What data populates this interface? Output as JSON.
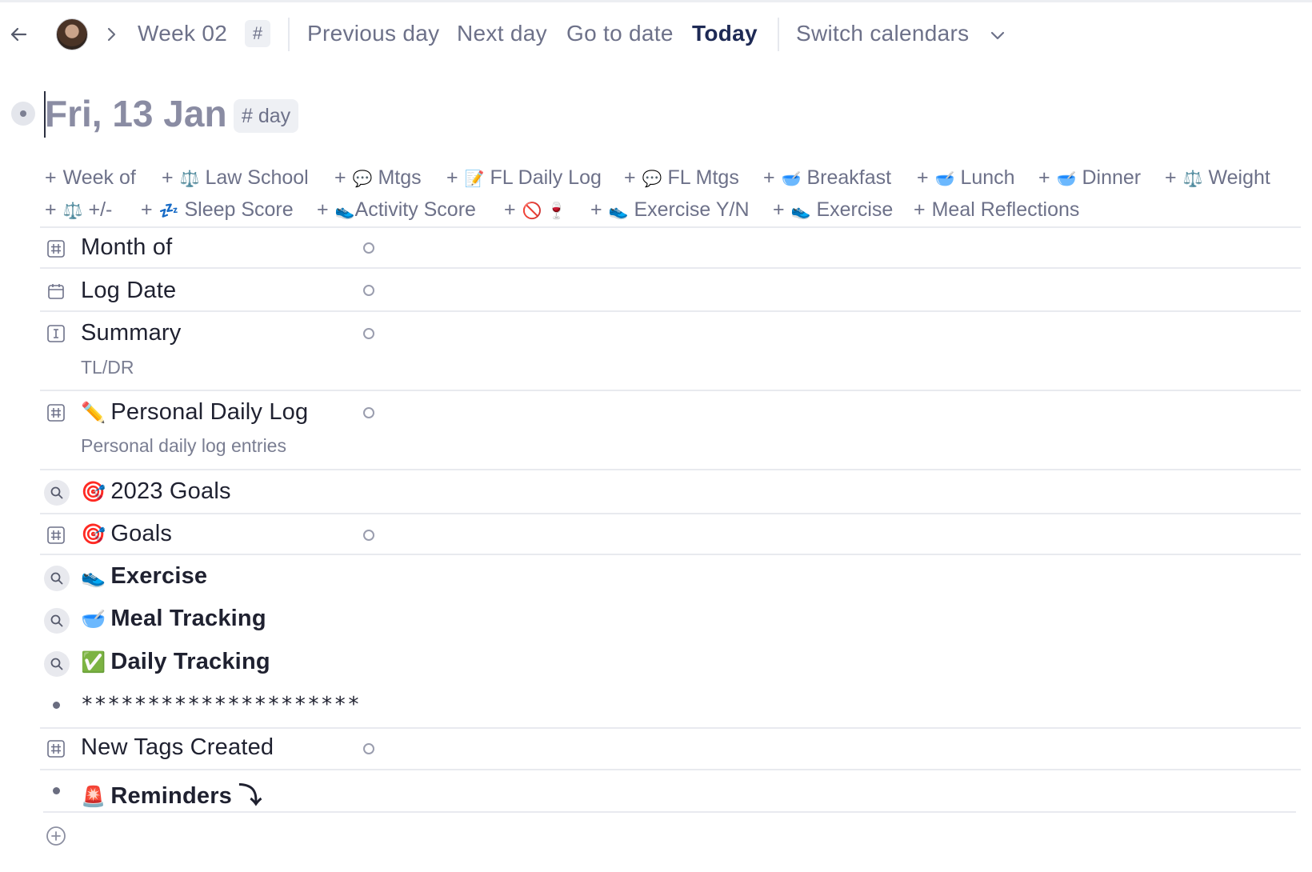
{
  "topbar": {
    "week_label": "Week 02",
    "week_hash": "#",
    "nav": {
      "previous_day": "Previous day",
      "next_day": "Next day",
      "go_to_date": "Go to date",
      "today": "Today",
      "switch_calendars": "Switch calendars"
    }
  },
  "page": {
    "title": "Fri, 13 Jan",
    "tag": "# day"
  },
  "add_fields": {
    "plus": "+",
    "row1": [
      {
        "emoji": "",
        "label": "Week of"
      },
      {
        "emoji": "⚖️",
        "label": "Law School"
      },
      {
        "emoji": "💬",
        "label": "Mtgs"
      },
      {
        "emoji": "📝",
        "label": "FL Daily Log"
      },
      {
        "emoji": "💬",
        "label": "FL Mtgs"
      },
      {
        "emoji": "🥣",
        "label": "Breakfast"
      },
      {
        "emoji": "🥣",
        "label": "Lunch"
      },
      {
        "emoji": "🥣",
        "label": "Dinner"
      },
      {
        "emoji": "⚖️",
        "label": "Weight"
      }
    ],
    "row2": [
      {
        "emoji": "⚖️",
        "label": "+/-"
      },
      {
        "emoji": "💤",
        "label": "Sleep Score"
      },
      {
        "emoji": "👟",
        "label": "Activity Score"
      },
      {
        "emoji": "🚫 🍷",
        "label": ""
      },
      {
        "emoji": "👟",
        "label": "Exercise Y/N"
      },
      {
        "emoji": "👟",
        "label": "Exercise"
      },
      {
        "emoji": "",
        "label": "Meal Reflections"
      }
    ]
  },
  "fields": {
    "month_of": {
      "label": "Month of",
      "icon": "hash-field-icon"
    },
    "log_date": {
      "label": "Log Date",
      "icon": "calendar-icon"
    },
    "summary": {
      "label": "Summary",
      "description": "TL/DR",
      "icon": "text-field-icon"
    },
    "personal_log": {
      "emoji": "✏️",
      "label": "Personal Daily Log",
      "description": "Personal daily log entries",
      "icon": "hash-field-icon"
    },
    "goals_2023": {
      "emoji": "🎯",
      "label": "2023 Goals",
      "icon": "search-icon"
    },
    "goals": {
      "emoji": "🎯",
      "label": "Goals",
      "icon": "hash-field-icon"
    },
    "exercise": {
      "emoji": "👟",
      "label": "Exercise",
      "icon": "search-icon"
    },
    "meal_tracking": {
      "emoji": "🥣",
      "label": "Meal Tracking",
      "icon": "search-icon"
    },
    "daily_tracking": {
      "emoji": "✅",
      "label": "Daily Tracking",
      "icon": "search-icon"
    },
    "stars_line": "*********************",
    "new_tags": {
      "label": "New Tags Created",
      "icon": "hash-field-icon"
    },
    "reminders": {
      "emoji": "🚨",
      "label": "Reminders ⤵"
    }
  }
}
